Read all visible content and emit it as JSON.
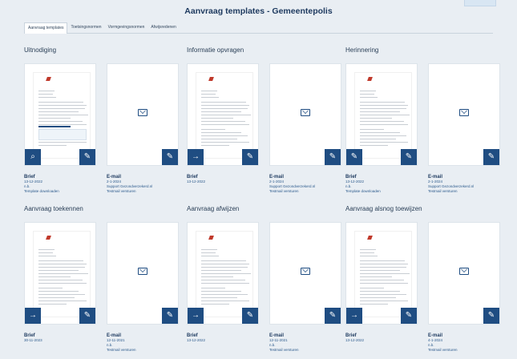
{
  "header": {
    "title": "Aanvraag templates - Gemeentepolis"
  },
  "tabs": [
    {
      "label": "Aanvraag templates",
      "active": true
    },
    {
      "label": "Toetsingsnormen"
    },
    {
      "label": "Vormgevingsnormen"
    },
    {
      "label": "Afwijsredenen"
    }
  ],
  "sections": [
    {
      "title": "Uitnodiging",
      "brief": {
        "title": "Brief",
        "lines": [
          "13-12-2022",
          "n.b.",
          "Template downloaden"
        ]
      },
      "email": {
        "title": "E-mail",
        "lines": [
          "2-1-2024",
          "Support Gezondverzekerd.nl",
          "Testmail versturen"
        ]
      },
      "left_button_icon": "search-icon"
    },
    {
      "title": "Informatie opvragen",
      "brief": {
        "title": "Brief",
        "lines": [
          "13-12-2022"
        ]
      },
      "email": {
        "title": "E-mail",
        "lines": [
          "2-1-2024",
          "Support Gezondverzekerd.nl",
          "Testmail versturen"
        ]
      },
      "left_button_icon": "arrow-right-icon"
    },
    {
      "title": "Herinnering",
      "brief": {
        "title": "Brief",
        "lines": [
          "13-12-2022",
          "n.b.",
          "Template downloaden"
        ]
      },
      "email": {
        "title": "E-mail",
        "lines": [
          "2-1-2024",
          "Support Gezondverzekerd.nl",
          "Testmail versturen"
        ]
      },
      "left_button_icon": "edit-icon"
    },
    {
      "title": "Aanvraag toekennen",
      "brief": {
        "title": "Brief",
        "lines": [
          "30-11-2023"
        ]
      },
      "email": {
        "title": "E-mail",
        "lines": [
          "12-11-2021",
          "n.b.",
          "Testmail versturen"
        ]
      },
      "left_button_icon": "arrow-right-icon"
    },
    {
      "title": "Aanvraag afwijzen",
      "brief": {
        "title": "Brief",
        "lines": [
          "13-12-2022"
        ]
      },
      "email": {
        "title": "E-mail",
        "lines": [
          "12-11-2021",
          "n.b.",
          "Testmail versturen"
        ]
      },
      "left_button_icon": "arrow-right-icon"
    },
    {
      "title": "Aanvraag alsnog toewijzen",
      "brief": {
        "title": "Brief",
        "lines": [
          "13-12-2022"
        ]
      },
      "email": {
        "title": "E-mail",
        "lines": [
          "4-1-2024",
          "n.b.",
          "Testmail versturen"
        ]
      },
      "left_button_icon": "arrow-right-icon"
    }
  ],
  "icons": {
    "search": "search-icon",
    "arrow": "arrow-right-icon",
    "edit": "edit-icon",
    "mail": "mail-icon"
  },
  "colors": {
    "accent": "#1f4d82",
    "background": "#e9eef3",
    "logo_red": "#c0392b"
  }
}
